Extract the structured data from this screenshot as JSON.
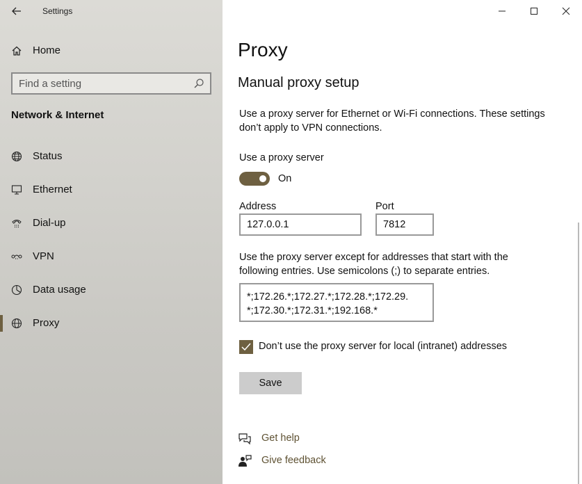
{
  "window": {
    "app_title": "Settings",
    "back_icon": "arrow-left-icon",
    "minimize_icon": "minimize-icon",
    "maximize_icon": "maximize-icon",
    "close_icon": "close-icon"
  },
  "sidebar": {
    "home_label": "Home",
    "search_placeholder": "Find a setting",
    "section_title": "Network & Internet",
    "items": [
      {
        "label": "Status",
        "icon": "globe-status-icon"
      },
      {
        "label": "Ethernet",
        "icon": "monitor-ethernet-icon"
      },
      {
        "label": "Dial-up",
        "icon": "dialup-phone-icon"
      },
      {
        "label": "VPN",
        "icon": "vpn-icon"
      },
      {
        "label": "Data usage",
        "icon": "data-usage-icon"
      },
      {
        "label": "Proxy",
        "icon": "globe-icon",
        "active": true
      }
    ]
  },
  "main": {
    "title": "Proxy",
    "subtitle": "Manual proxy setup",
    "description": "Use a proxy server for Ethernet or Wi-Fi connections. These settings don’t apply to VPN connections.",
    "use_proxy_label": "Use a proxy server",
    "toggle_state": "On",
    "address_label": "Address",
    "address_value": "127.0.0.1",
    "port_label": "Port",
    "port_value": "7812",
    "exceptions_description": "Use the proxy server except for addresses that start with the following entries. Use semicolons (;) to separate entries.",
    "exceptions_lines": [
      "*;172.26.*;172.27.*;172.28.*;172.29.",
      "*;172.30.*;172.31.*;192.168.*"
    ],
    "local_checkbox_label": "Don’t use the proxy server for local (intranet) addresses",
    "save_label": "Save",
    "help_label": "Get help",
    "feedback_label": "Give feedback"
  },
  "colors": {
    "accent": "#6e6041",
    "link": "#5e5132",
    "sidebar_bg": "#d3d2cd"
  }
}
